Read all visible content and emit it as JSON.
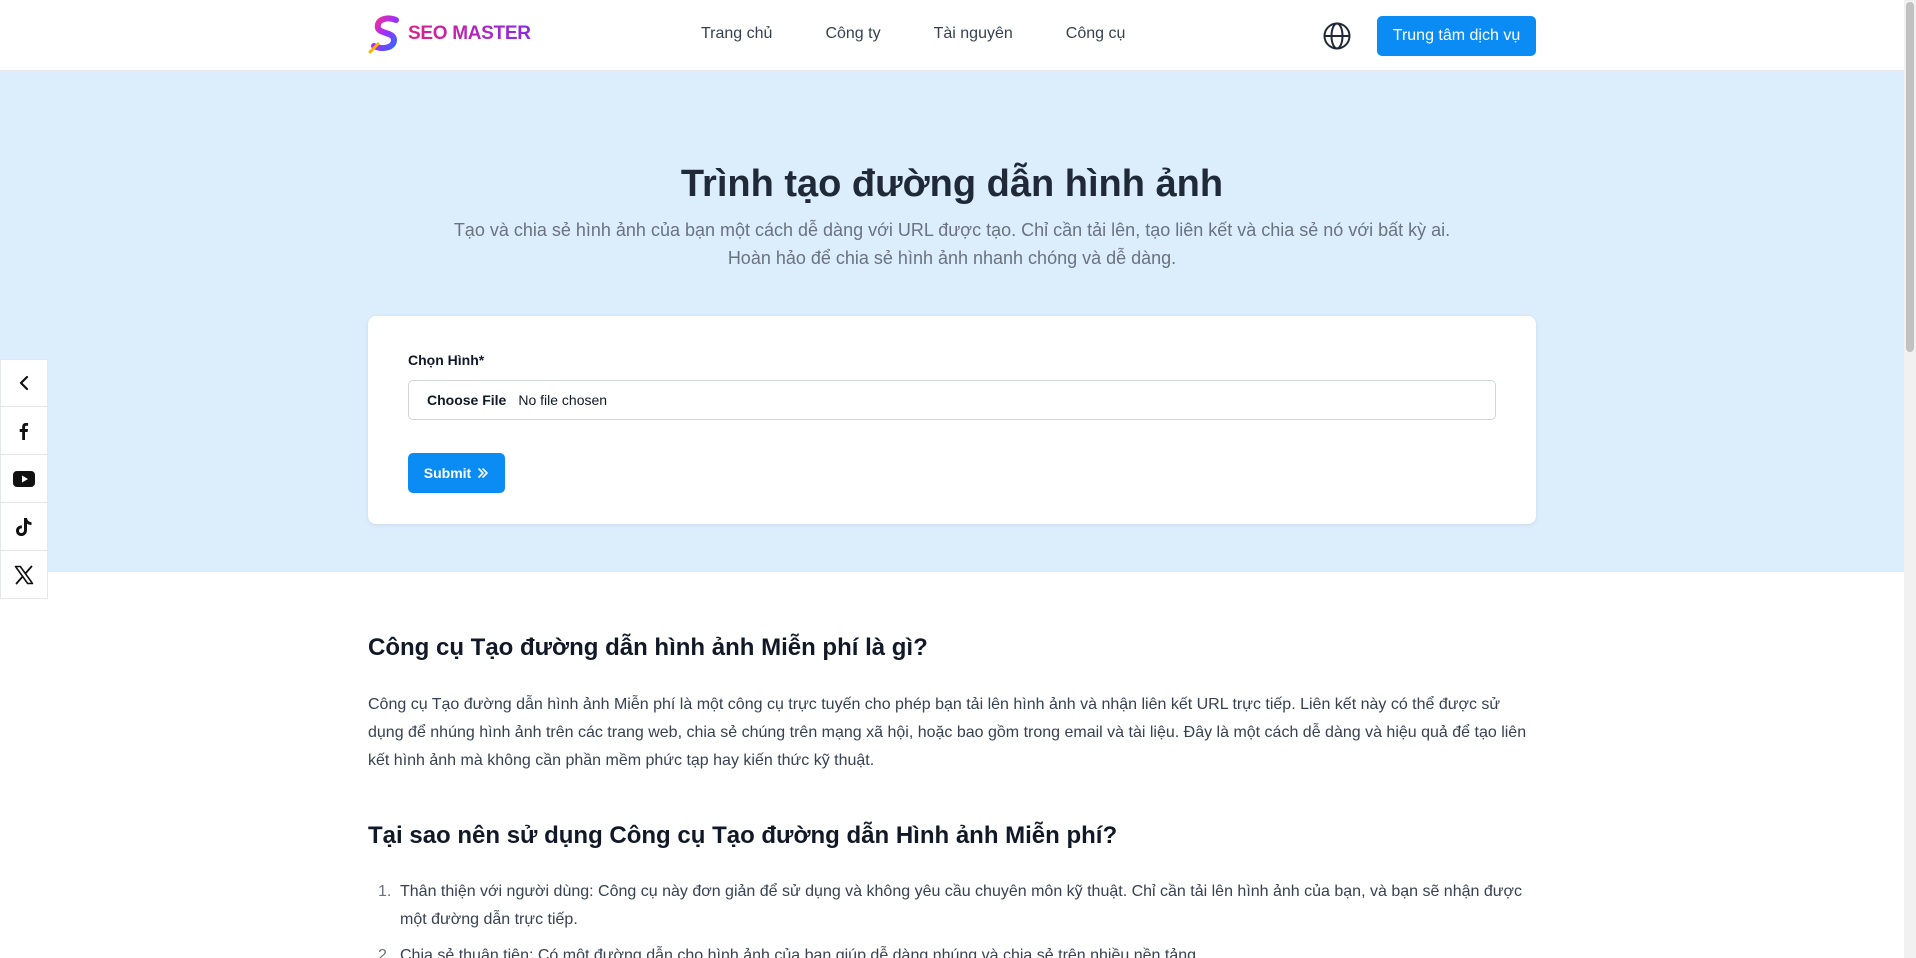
{
  "header": {
    "logo_text": "SEO MASTER",
    "nav": [
      "Trang chủ",
      "Công ty",
      "Tài nguyên",
      "Công cụ"
    ],
    "cta_label": "Trung tâm dịch vụ",
    "accent_color": "#0b8cf5"
  },
  "hero": {
    "title": "Trình tạo đường dẫn hình ảnh",
    "subtitle": "Tạo và chia sẻ hình ảnh của bạn một cách dễ dàng với URL được tạo. Chỉ cần tải lên, tạo liên kết và chia sẻ nó với bất kỳ ai. Hoàn hảo để chia sẻ hình ảnh nhanh chóng và dễ dàng."
  },
  "form": {
    "label": "Chọn Hình*",
    "file_button": "Choose File",
    "file_status": "No file chosen",
    "submit_label": "Submit"
  },
  "social": [
    "chevron-left-icon",
    "facebook-icon",
    "youtube-icon",
    "tiktok-icon",
    "x-icon"
  ],
  "content": {
    "h2_1": "Công cụ Tạo đường dẫn hình ảnh Miễn phí là gì?",
    "p_1": "Công cụ Tạo đường dẫn hình ảnh Miễn phí là một công cụ trực tuyến cho phép bạn tải lên hình ảnh và nhận liên kết URL trực tiếp. Liên kết này có thể được sử dụng để nhúng hình ảnh trên các trang web, chia sẻ chúng trên mạng xã hội, hoặc bao gồm trong email và tài liệu. Đây là một cách dễ dàng và hiệu quả để tạo liên kết hình ảnh mà không cần phần mềm phức tạp hay kiến thức kỹ thuật.",
    "h2_2": "Tại sao nên sử dụng Công cụ Tạo đường dẫn Hình ảnh Miễn phí?",
    "list": [
      {
        "num": "1.",
        "text": "Thân thiện với người dùng: Công cụ này đơn giản để sử dụng và không yêu cầu chuyên môn kỹ thuật. Chỉ cần tải lên hình ảnh của bạn, và bạn sẽ nhận được một đường dẫn trực tiếp."
      },
      {
        "num": "2.",
        "text": "Chia sẻ thuận tiện: Có một đường dẫn cho hình ảnh của bạn giúp dễ dàng nhúng và chia sẻ trên nhiều nền tảng."
      }
    ]
  }
}
